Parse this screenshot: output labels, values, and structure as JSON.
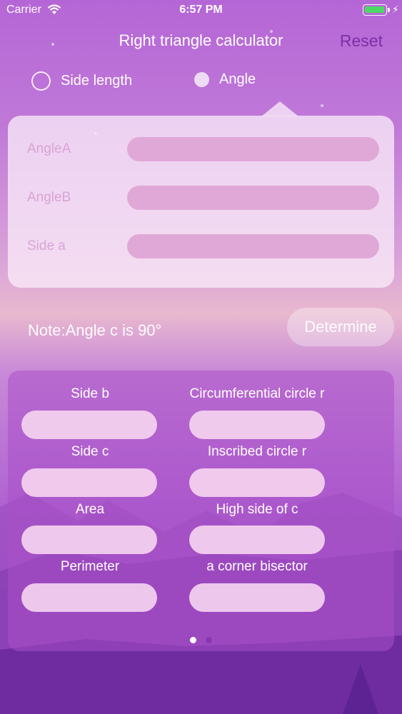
{
  "status_bar": {
    "carrier": "Carrier",
    "time": "6:57 PM",
    "battery_level": 1.0,
    "battery_color": "#4cd964",
    "charging_icon": "bolt-icon"
  },
  "nav": {
    "title": "Right triangle calculator",
    "reset_label": "Reset"
  },
  "mode": {
    "options": [
      {
        "label": "Side length",
        "selected": false
      },
      {
        "label": "Angle",
        "selected": true
      }
    ]
  },
  "inputs": [
    {
      "label": "AngleA",
      "value": ""
    },
    {
      "label": "AngleB",
      "value": ""
    },
    {
      "label": "Side a",
      "value": ""
    }
  ],
  "note": "Note:Angle c is 90°",
  "determine_label": "Determine",
  "results": [
    {
      "label": "Side b",
      "value": ""
    },
    {
      "label": "Circumferential circle r",
      "value": ""
    },
    {
      "label": "Side c",
      "value": ""
    },
    {
      "label": "Inscribed circle r",
      "value": ""
    },
    {
      "label": "Area",
      "value": ""
    },
    {
      "label": "High side of c",
      "value": ""
    },
    {
      "label": "Perimeter",
      "value": ""
    },
    {
      "label": "a corner bisector",
      "value": ""
    }
  ],
  "pager": {
    "page_count": 2,
    "current_page": 1
  },
  "colors": {
    "accent": "#7b2fa6",
    "input_fill": "#e0a8d7",
    "label_muted": "#d9a4d4"
  }
}
